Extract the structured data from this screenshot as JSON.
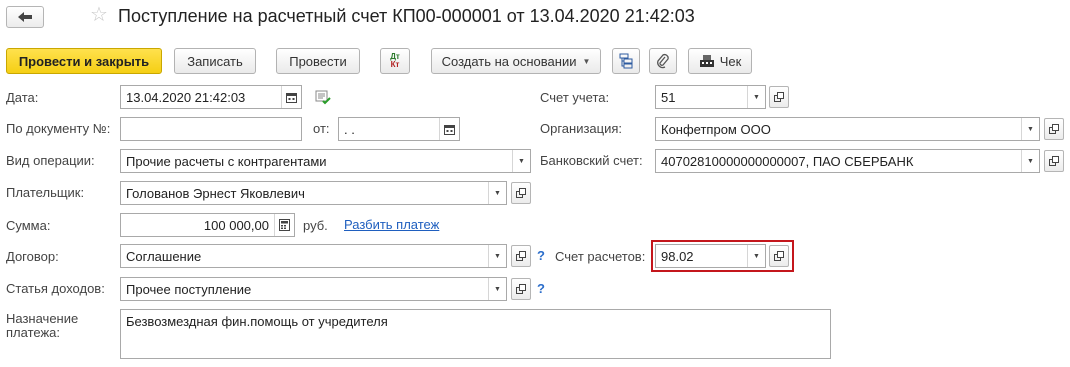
{
  "header": {
    "title": "Поступление на расчетный счет КП00-000001 от 13.04.2020 21:42:03"
  },
  "toolbar": {
    "post_close": "Провести и закрыть",
    "save": "Записать",
    "post": "Провести",
    "dtkt_dt": "Дт",
    "dtkt_kt": "Кт",
    "create_based": "Создать на основании",
    "receipt": "Чек"
  },
  "form": {
    "date_label": "Дата:",
    "date_value": "13.04.2020 21:42:03",
    "doc_number_label": "По документу №:",
    "doc_number_value": "",
    "from_label": "от:",
    "from_value": " .  .",
    "operation_label": "Вид операции:",
    "operation_value": "Прочие расчеты с контрагентами",
    "payer_label": "Плательщик:",
    "payer_value": "Голованов Эрнест Яковлевич",
    "amount_label": "Сумма:",
    "amount_value": "100 000,00",
    "currency": "руб.",
    "split_payment_link": "Разбить платеж",
    "contract_label": "Договор:",
    "contract_value": "Соглашение",
    "income_item_label": "Статья доходов:",
    "income_item_value": "Прочее поступление",
    "purpose_label_line1": "Назначение",
    "purpose_label_line2": "платежа:",
    "purpose_value": "Безвозмездная фин.помощь от учредителя",
    "account_label": "Счет учета:",
    "account_value": "51",
    "org_label": "Организация:",
    "org_value": "Конфетпром ООО",
    "bank_account_label": "Банковский счет:",
    "bank_account_value": "40702810000000000007, ПАО СБЕРБАНК",
    "settlement_account_label": "Счет расчетов:",
    "settlement_account_value": "98.02",
    "help_mark": "?"
  },
  "colors": {
    "primary_button": "#f5cf14",
    "highlight_border": "#c4161c",
    "link": "#1f5fbf"
  }
}
